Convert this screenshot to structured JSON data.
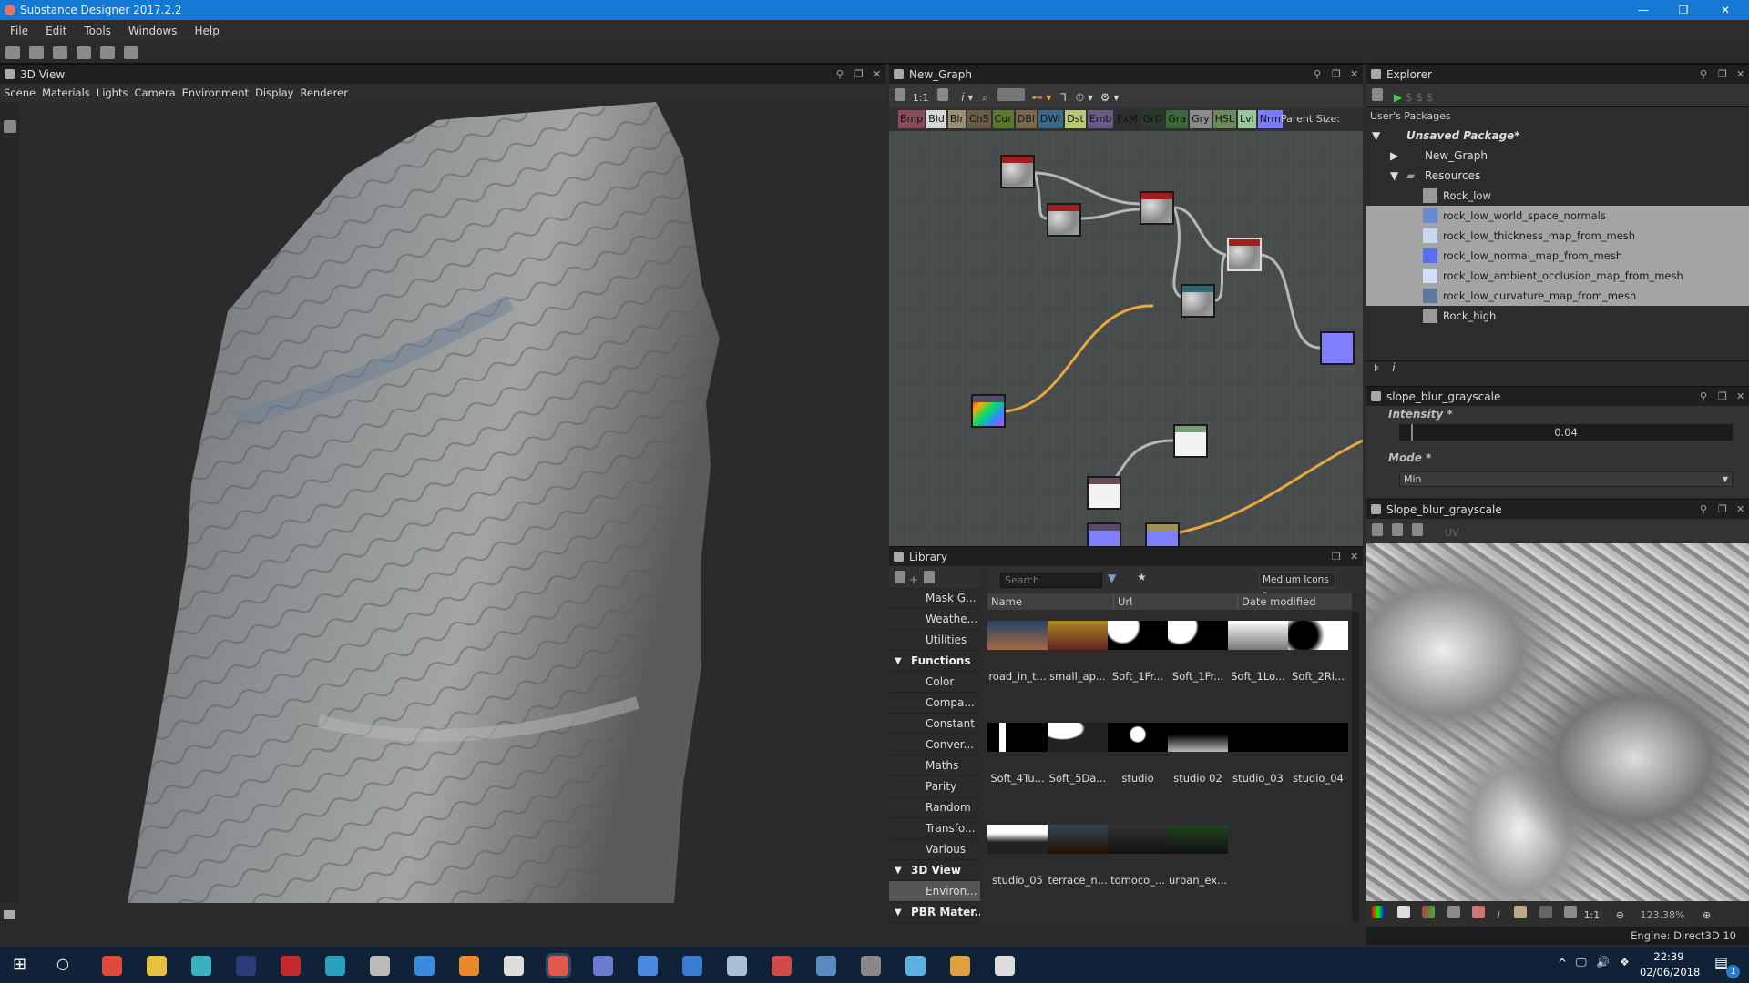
{
  "app": {
    "title": "Substance Designer 2017.2.2",
    "menu": [
      "File",
      "Edit",
      "Tools",
      "Windows",
      "Help"
    ]
  },
  "view3d": {
    "title": "3D View",
    "menu": [
      "Scene",
      "Materials",
      "Lights",
      "Camera",
      "Environment",
      "Display",
      "Renderer"
    ]
  },
  "graph": {
    "title": "New_Graph",
    "zoom_label": "1:1",
    "node_buttons": [
      {
        "label": "Bmp",
        "color": "#8a4a5a"
      },
      {
        "label": "Bld",
        "color": "#d8d8d8"
      },
      {
        "label": "Blr",
        "color": "#9a9070"
      },
      {
        "label": "ChS",
        "color": "#6a5a4a"
      },
      {
        "label": "Cur",
        "color": "#5a7a2a"
      },
      {
        "label": "DBl",
        "color": "#7a6a4a"
      },
      {
        "label": "DWr",
        "color": "#3a6a8a"
      },
      {
        "label": "Dst",
        "color": "#b8c878"
      },
      {
        "label": "Emb",
        "color": "#6a5a8a"
      },
      {
        "label": "FxM",
        "color": "#2e2e2e"
      },
      {
        "label": "GrD",
        "color": "#2a3a2a"
      },
      {
        "label": "Gra",
        "color": "#3a6a3a"
      },
      {
        "label": "Gry",
        "color": "#8a8a8a"
      },
      {
        "label": "HSL",
        "color": "#6a8a5a"
      },
      {
        "label": "Lvl",
        "color": "#9ac89a"
      },
      {
        "label": "Nrm",
        "color": "#7a7aff"
      }
    ],
    "parent_size_label": "Parent Size:"
  },
  "explorer": {
    "title": "Explorer",
    "section": "User's Packages",
    "package": "Unsaved Package*",
    "graph": "New_Graph",
    "folder": "Resources",
    "resources": [
      {
        "name": "Rock_low",
        "selected": false,
        "thumb": "#999"
      },
      {
        "name": "rock_low_world_space_normals",
        "selected": true,
        "thumb": "#6a8ad0"
      },
      {
        "name": "rock_low_thickness_map_from_mesh",
        "selected": true,
        "thumb": "#c8d8f0"
      },
      {
        "name": "rock_low_normal_map_from_mesh",
        "selected": true,
        "thumb": "#5a70f0"
      },
      {
        "name": "rock_low_ambient_occlusion_map_from_mesh",
        "selected": true,
        "thumb": "#d0e0f8"
      },
      {
        "name": "rock_low_curvature_map_from_mesh",
        "selected": true,
        "thumb": "#5a7aa0"
      },
      {
        "name": "Rock_high",
        "selected": false,
        "thumb": "#999"
      }
    ]
  },
  "properties": {
    "title": "slope_blur_grayscale",
    "intensity_label": "Intensity *",
    "intensity_value": "0.04",
    "intensity_fraction": 0.04,
    "mode_label": "Mode *",
    "mode_value": "Min"
  },
  "preview": {
    "title": "Slope_blur_grayscale",
    "uv_label": "UV",
    "one_to_one": "1:1",
    "zoom": "123.38%"
  },
  "status": {
    "engine": "Engine: Direct3D 10"
  },
  "library": {
    "title": "Library",
    "search_placeholder": "Search",
    "view_mode": "Medium Icons",
    "columns": [
      "Name",
      "Url",
      "Date modified"
    ],
    "tree": [
      {
        "label": "Mask G...",
        "cat": false
      },
      {
        "label": "Weathe...",
        "cat": false
      },
      {
        "label": "Utilities",
        "cat": false
      },
      {
        "label": "Functions",
        "cat": true
      },
      {
        "label": "Color",
        "cat": false
      },
      {
        "label": "Compa...",
        "cat": false
      },
      {
        "label": "Constant",
        "cat": false
      },
      {
        "label": "Conver...",
        "cat": false
      },
      {
        "label": "Maths",
        "cat": false
      },
      {
        "label": "Parity",
        "cat": false
      },
      {
        "label": "Random",
        "cat": false
      },
      {
        "label": "Transfo...",
        "cat": false
      },
      {
        "label": "Various",
        "cat": false
      },
      {
        "label": "3D View",
        "cat": true
      },
      {
        "label": "Environ...",
        "cat": false
      },
      {
        "label": "PBR Mater...",
        "cat": true
      }
    ],
    "items": [
      "road_in_t...",
      "small_ap...",
      "Soft_1Fr...",
      "Soft_1Fr...",
      "Soft_1Lo...",
      "Soft_2Ri...",
      "Soft_4Tu...",
      "Soft_5Da...",
      "studio",
      "studio 02",
      "studio_03",
      "studio_04",
      "studio_05",
      "terrace_n...",
      "tomoco_...",
      "urban_ex..."
    ]
  },
  "taskbar": {
    "time": "22:39",
    "date": "02/06/2018",
    "notifications": "1",
    "icons": [
      {
        "name": "chrome",
        "color": "#e04a3a"
      },
      {
        "name": "explorer",
        "color": "#e8c040"
      },
      {
        "name": "maya",
        "color": "#3ab0c0"
      },
      {
        "name": "photoshop",
        "color": "#2a3a7a"
      },
      {
        "name": "app-red",
        "color": "#c02a2a"
      },
      {
        "name": "app-cyan",
        "color": "#2aa0c0"
      },
      {
        "name": "app-gray",
        "color": "#bbbbbb"
      },
      {
        "name": "app-blue",
        "color": "#3a8ae0"
      },
      {
        "name": "blender",
        "color": "#e88a2a"
      },
      {
        "name": "unity",
        "color": "#dddddd"
      },
      {
        "name": "substance-designer",
        "color": "#e05a4a"
      },
      {
        "name": "discord",
        "color": "#6a7ad0"
      },
      {
        "name": "app-blue2",
        "color": "#4a8ae0"
      },
      {
        "name": "app-blue3",
        "color": "#3a7ad0"
      },
      {
        "name": "steam",
        "color": "#aac0d8"
      },
      {
        "name": "substance-painter",
        "color": "#d04a4a"
      },
      {
        "name": "app-monitor",
        "color": "#5a8ac0"
      },
      {
        "name": "app-dark",
        "color": "#888888"
      },
      {
        "name": "app-sky",
        "color": "#5ab0e0"
      },
      {
        "name": "app-orange",
        "color": "#e0a040"
      },
      {
        "name": "photos",
        "color": "#dddddd"
      }
    ]
  }
}
